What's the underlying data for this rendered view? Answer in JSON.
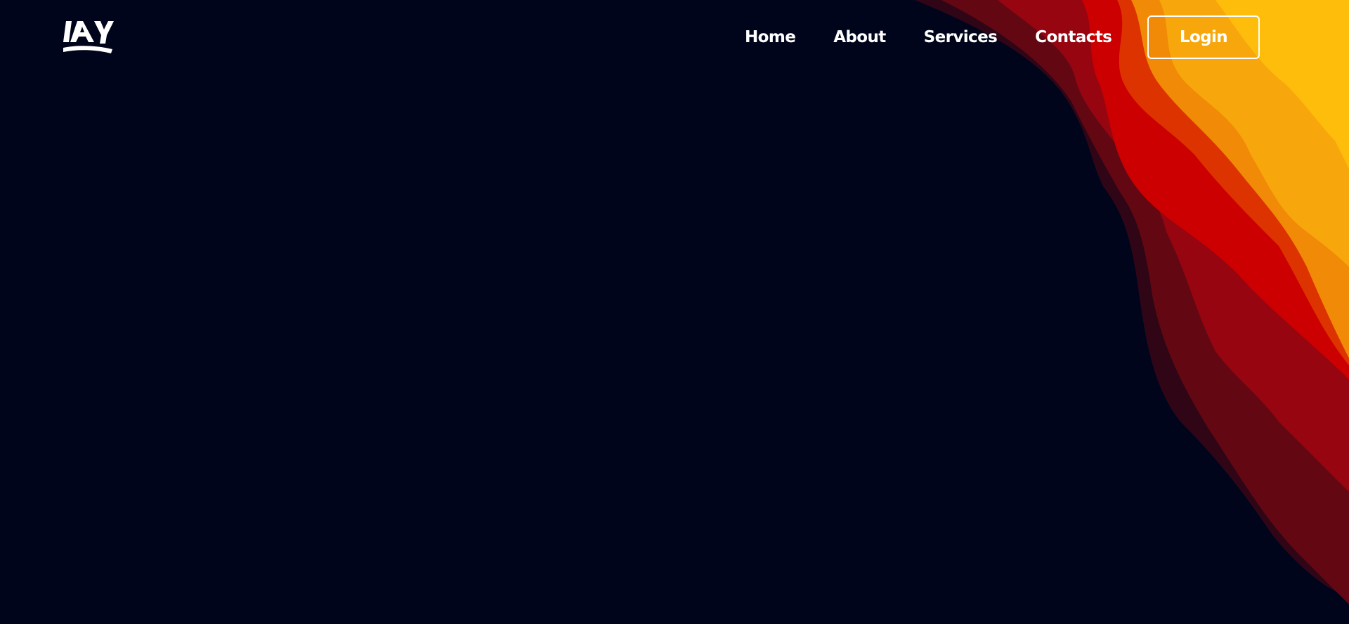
{
  "brand": {
    "logo_icon": "LAY monogram logo",
    "background_color": "#00051b",
    "wave_colors": [
      "#300617",
      "#630812",
      "#960510",
      "#cc0001",
      "#dd3300",
      "#f08a07",
      "#f7a70b",
      "#ffbd0b"
    ]
  },
  "nav": {
    "links": [
      {
        "label": "Home"
      },
      {
        "label": "About"
      },
      {
        "label": "Services"
      },
      {
        "label": "Contacts"
      }
    ],
    "login_label": "Login"
  }
}
